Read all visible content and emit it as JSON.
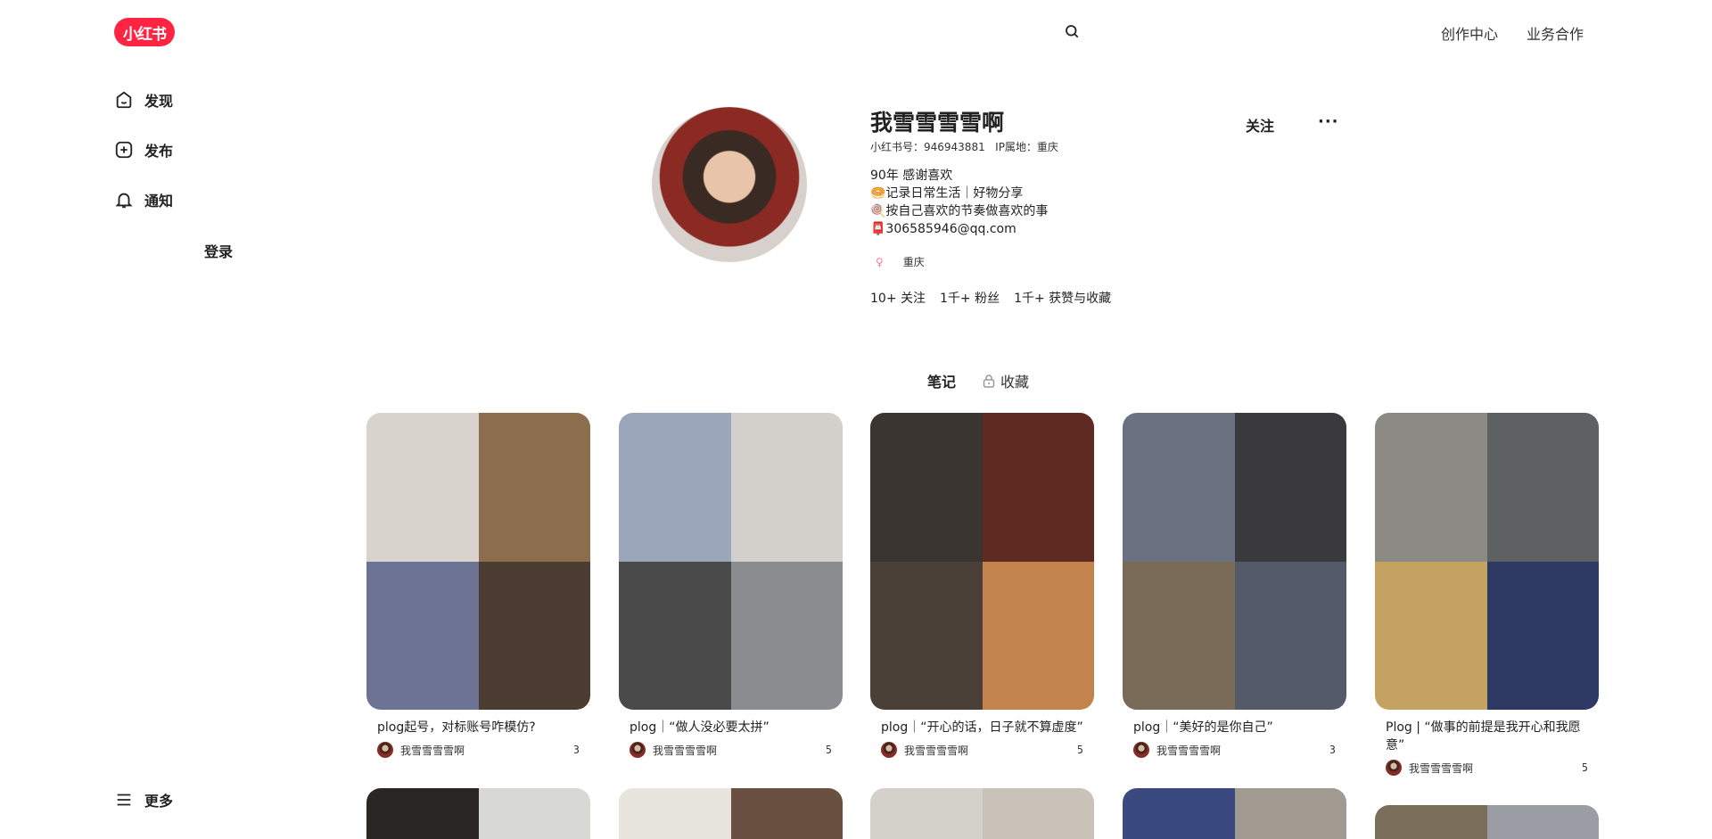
{
  "header": {
    "logo": "小红书",
    "search_icon": "search-icon",
    "links": [
      "创作中心",
      "业务合作"
    ]
  },
  "sidebar": {
    "items": [
      {
        "label": "发现",
        "icon": "home-icon"
      },
      {
        "label": "发布",
        "icon": "plus-square-icon"
      },
      {
        "label": "通知",
        "icon": "bell-icon"
      }
    ],
    "login": "登录",
    "more": "更多"
  },
  "profile": {
    "name": "我雪雪雪雪啊",
    "id_line": "小红书号：946943881   IP属地：重庆",
    "bio": [
      "90年 感谢喜欢",
      "🥯记录日常生活｜好物分享",
      "🍭按自己喜欢的节奏做喜欢的事",
      "📮306585946@qq.com"
    ],
    "gender": "♀",
    "location": "重庆",
    "stats": [
      "10+ 关注",
      "1千+ 粉丝",
      "1千+ 获赞与收藏"
    ],
    "follow": "关注",
    "more": "···",
    "accent": "#ff2442"
  },
  "tabs": [
    {
      "label": "笔记",
      "active": true
    },
    {
      "label": "收藏",
      "locked": true
    }
  ],
  "notes": [
    {
      "title": "plog起号，对标账号咋模仿?",
      "author": "我雪雪雪雪啊",
      "likes": "3",
      "colors": [
        "#d9d3cd",
        "#8c6e4e",
        "#6c7394",
        "#4c3c32"
      ]
    },
    {
      "title": "plog｜“做人没必要太拼”",
      "author": "我雪雪雪雪啊",
      "likes": "5",
      "colors": [
        "#9aa6ba",
        "#d3cfcb",
        "#4a4a4a",
        "#8a8c90"
      ]
    },
    {
      "title": "plog｜“开心的话，日子就不算虚度”",
      "author": "我雪雪雪雪啊",
      "likes": "5",
      "colors": [
        "#3b3531",
        "#5e2a22",
        "#4a4038",
        "#c3834c"
      ]
    },
    {
      "title": "plog｜“美好的是你自己”",
      "author": "我雪雪雪雪啊",
      "likes": "3",
      "colors": [
        "#6a7282",
        "#3a3a3c",
        "#7a6a58",
        "#535a6a"
      ]
    },
    {
      "title": "Plog | “做事的前提是我开心和我愿意”",
      "author": "我雪雪雪雪啊",
      "likes": "5",
      "colors": [
        "#8c8a84",
        "#5f6062",
        "#c4a262",
        "#2f3a64"
      ]
    }
  ],
  "next_row_colors": [
    [
      "#2a2624",
      "#d8d8d4"
    ],
    [
      "#e8e4de",
      "#6a5040"
    ],
    [
      "#d4d0ca",
      "#c8c2b8"
    ],
    [
      "#3a4a80",
      "#a09a90"
    ],
    [
      "#7a6e5a",
      "#9a9ea4"
    ]
  ]
}
